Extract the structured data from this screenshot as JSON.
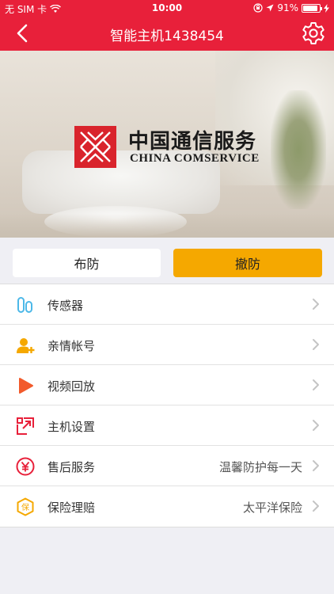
{
  "status_bar": {
    "carrier": "无 SIM 卡",
    "time": "10:00",
    "battery": "91%"
  },
  "nav": {
    "title": "智能主机1438454"
  },
  "hero": {
    "logo_cn": "中国通信服务",
    "logo_en": "CHINA COMSERVICE"
  },
  "actions": {
    "arm_label": "布防",
    "disarm_label": "撤防"
  },
  "menu": {
    "items": [
      {
        "label": "传感器",
        "value": "",
        "icon": "sensor-icon"
      },
      {
        "label": "亲情帐号",
        "value": "",
        "icon": "family-account-icon"
      },
      {
        "label": "视频回放",
        "value": "",
        "icon": "play-icon"
      },
      {
        "label": "主机设置",
        "value": "",
        "icon": "host-settings-icon"
      },
      {
        "label": "售后服务",
        "value": "温馨防护每一天",
        "icon": "yen-service-icon"
      },
      {
        "label": "保险理赔",
        "value": "太平洋保险",
        "icon": "insurance-icon"
      }
    ]
  },
  "colors": {
    "brand_red": "#e8203a",
    "disarm_orange": "#f5a800",
    "background": "#efeff4"
  }
}
